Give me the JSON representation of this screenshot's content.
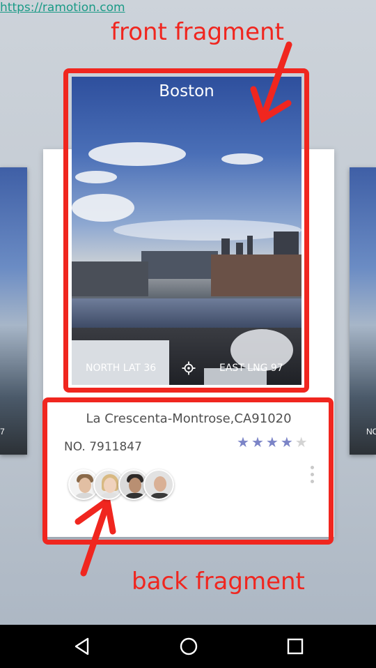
{
  "header": {
    "url": "https://ramotion.com"
  },
  "annotations": {
    "front_label": "front fragment",
    "back_label": "back fragment"
  },
  "card": {
    "city": "Boston",
    "lat": "NORTH LAT 36",
    "lng": "EAST LNG 97",
    "address": "La Crescenta-Montrose,CA91020",
    "number": "NO. 7911847",
    "rating": 4,
    "rating_max": 5
  },
  "side_cards": {
    "right_label": "NC",
    "left_label": "7"
  },
  "avatars": [
    {
      "name": "avatar-man-glasses"
    },
    {
      "name": "avatar-woman-blonde"
    },
    {
      "name": "avatar-man-dark"
    },
    {
      "name": "avatar-man-bald"
    }
  ],
  "colors": {
    "annotation_red": "#f0261f",
    "star_filled": "#7b84c7",
    "star_empty": "#d3d3d3",
    "link_teal": "#1a9a86"
  },
  "icons": {
    "locate": "crosshair-icon",
    "more": "more-vert-icon",
    "nav_back": "triangle-back-icon",
    "nav_home": "circle-home-icon",
    "nav_recent": "square-recent-icon"
  }
}
